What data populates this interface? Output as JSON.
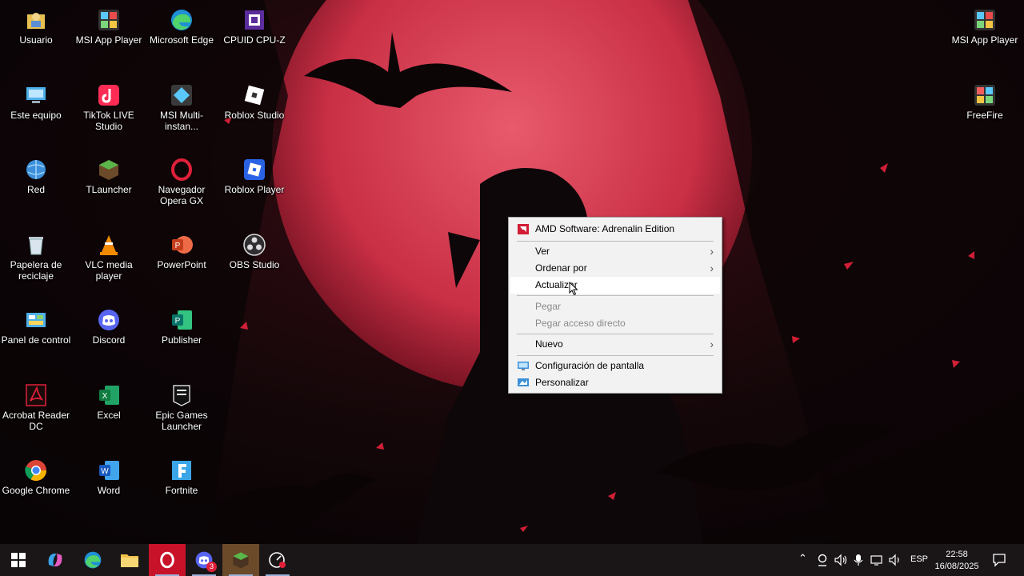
{
  "desktop": {
    "icons": [
      {
        "label": "Usuario",
        "icon": "user-folder-icon"
      },
      {
        "label": "MSI App Player",
        "icon": "msi-app-player-icon"
      },
      {
        "label": "Microsoft Edge",
        "icon": "edge-icon"
      },
      {
        "label": "CPUID CPU-Z",
        "icon": "cpuz-icon"
      },
      {
        "label": "Este equipo",
        "icon": "this-pc-icon"
      },
      {
        "label": "TikTok LIVE Studio",
        "icon": "tiktok-live-icon"
      },
      {
        "label": "MSI Multi-instan...",
        "icon": "msi-multi-instance-icon"
      },
      {
        "label": "Roblox Studio",
        "icon": "roblox-studio-icon"
      },
      {
        "label": "Red",
        "icon": "network-icon"
      },
      {
        "label": "TLauncher",
        "icon": "tlauncher-icon"
      },
      {
        "label": "Navegador Opera GX",
        "icon": "opera-gx-icon"
      },
      {
        "label": "Roblox Player",
        "icon": "roblox-player-icon"
      },
      {
        "label": "Papelera de reciclaje",
        "icon": "recycle-bin-icon"
      },
      {
        "label": "VLC media player",
        "icon": "vlc-icon"
      },
      {
        "label": "PowerPoint",
        "icon": "powerpoint-icon"
      },
      {
        "label": "OBS Studio",
        "icon": "obs-icon"
      },
      {
        "label": "Panel de control",
        "icon": "control-panel-icon"
      },
      {
        "label": "Discord",
        "icon": "discord-icon"
      },
      {
        "label": "Publisher",
        "icon": "publisher-icon"
      },
      {
        "label": "Acrobat Reader DC",
        "icon": "acrobat-icon"
      },
      {
        "label": "Excel",
        "icon": "excel-icon"
      },
      {
        "label": "Epic Games Launcher",
        "icon": "epic-games-icon"
      },
      {
        "label": "Google Chrome",
        "icon": "chrome-icon"
      },
      {
        "label": "Word",
        "icon": "word-icon"
      },
      {
        "label": "Fortnite",
        "icon": "fortnite-icon"
      },
      {
        "label": "MSI App Player",
        "icon": "msi-app-player-icon"
      },
      {
        "label": "FreeFire",
        "icon": "freefire-icon"
      }
    ]
  },
  "context_menu": {
    "amd": "AMD Software: Adrenalin Edition",
    "ver": "Ver",
    "ordenar": "Ordenar por",
    "actualizar": "Actualizar",
    "pegar": "Pegar",
    "pegar_acceso": "Pegar acceso directo",
    "nuevo": "Nuevo",
    "config_pantalla": "Configuración de pantalla",
    "personalizar": "Personalizar",
    "submenu_arrow": "›"
  },
  "taskbar": {
    "discord_badge": "3",
    "language": "ESP",
    "time": "22:58",
    "date": "16/08/2025"
  },
  "colors": {
    "accent": "#e0203a",
    "moon": "#d8394f",
    "menu_bg": "#f2f2f2"
  }
}
